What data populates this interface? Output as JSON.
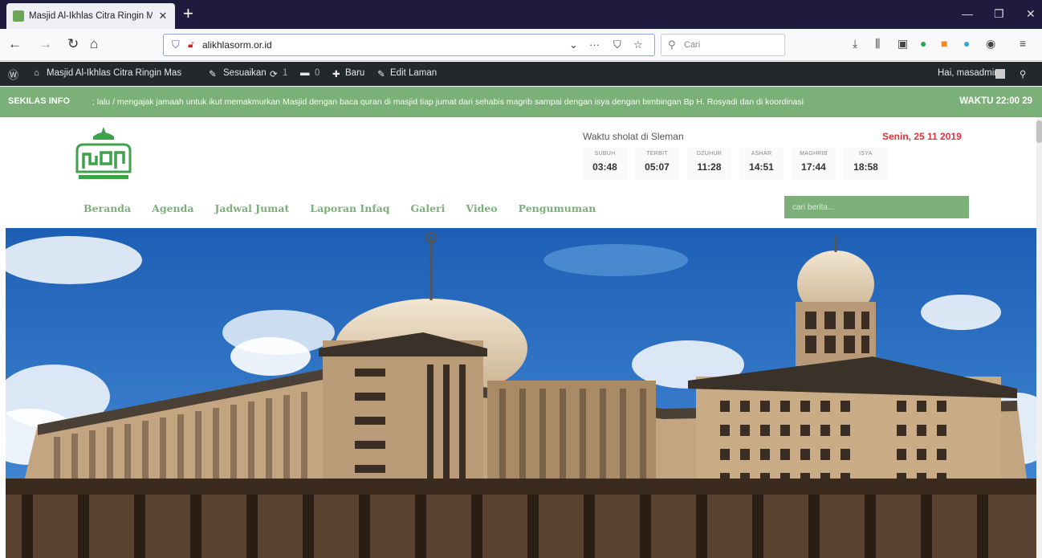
{
  "browser": {
    "tab_title": "Masjid Al-Ikhlas Citra Ringin M",
    "tab_close": "✕",
    "new_tab": "+",
    "url": "alikhlasorm.or.id",
    "search_placeholder": "Cari",
    "toolbar_icons": [
      "download-icon",
      "library-icon",
      "sidebar-icon",
      "extension-icon",
      "extension-icon",
      "extension-icon",
      "account-icon",
      "menu-icon"
    ]
  },
  "wp_admin_bar": {
    "site_name": "Masjid Al-Ikhlas Citra Ringin Mas",
    "customize": "Sesuaikan",
    "updates_count": "1",
    "comments_count": "0",
    "new": "Baru",
    "edit": "Edit Laman",
    "greeting": "Hai, masadmin"
  },
  "ticker": {
    "label": "SEKILAS INFO",
    "text": "; lalu / mengajak jamaah untuk ikut memakmurkan Masjid dengan baca quran di masjid tiap jumat dari sehabis magrib sampai dengan isya dengan bimbingan Bp H. Rosyadi  dan di koordinasi",
    "time": "WAKTU 22:00 29"
  },
  "prayer": {
    "title": "Waktu sholat di Sleman",
    "date": "Senin, 25 11 2019",
    "times": [
      {
        "name": "SUBUH",
        "time": "03:48"
      },
      {
        "name": "TERBIT",
        "time": "05:07"
      },
      {
        "name": "DZUHUR",
        "time": "11:28"
      },
      {
        "name": "ASHAR",
        "time": "14:51"
      },
      {
        "name": "MAGHRIB",
        "time": "17:44"
      },
      {
        "name": "ISYA",
        "time": "18:58"
      }
    ]
  },
  "menu": [
    "Beranda",
    "Agenda",
    "Jadwal Jumat",
    "Laporan Infaq",
    "Galeri",
    "Video",
    "Pengumuman"
  ],
  "site_search_placeholder": "cari berita..."
}
